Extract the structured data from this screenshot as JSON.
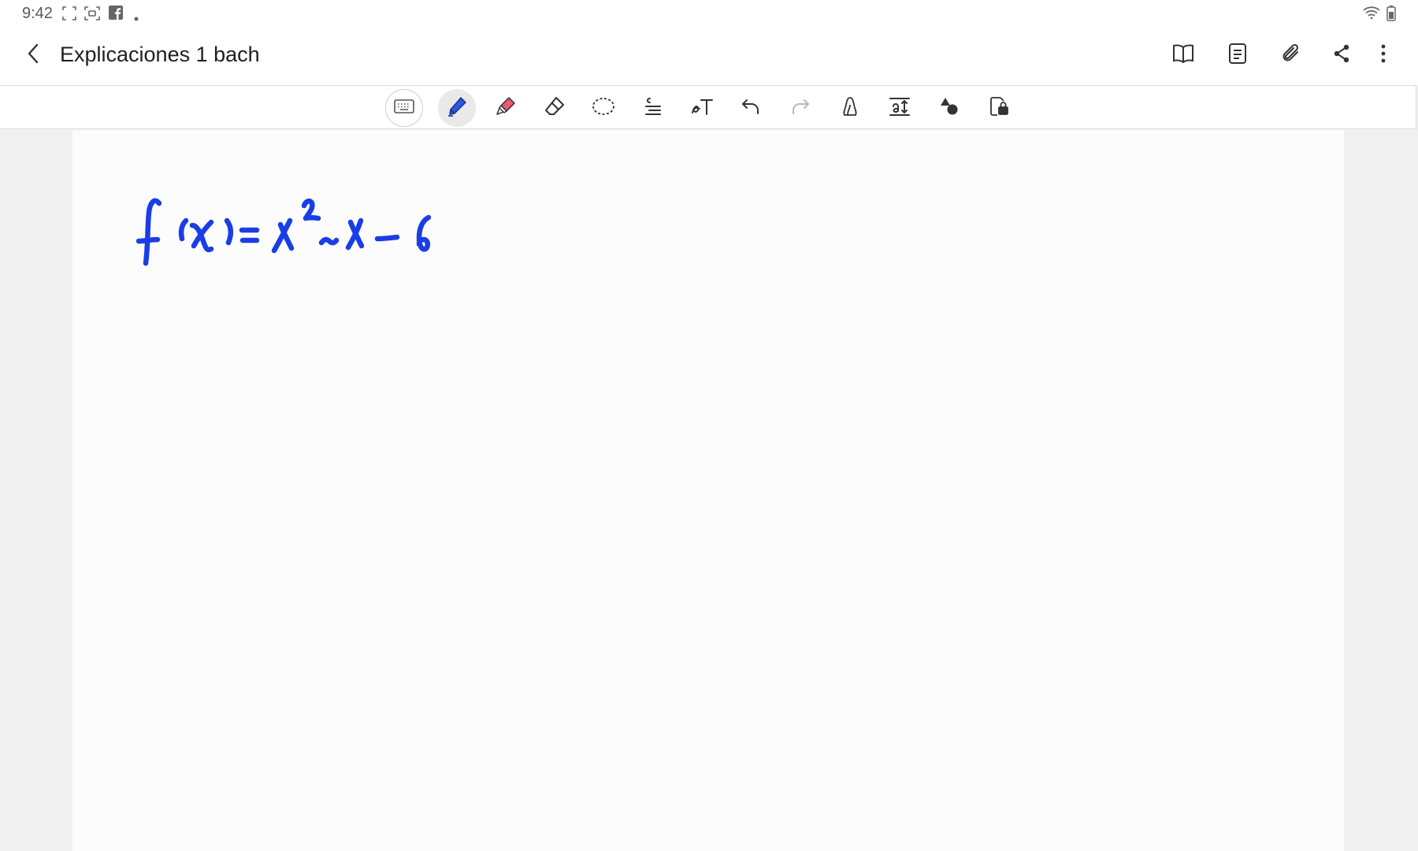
{
  "status_bar": {
    "time": "9:42",
    "icons": [
      "screenshot-frame-icon",
      "screen-record-icon",
      "facebook-icon",
      "notification-dot-icon",
      "wifi-icon",
      "battery-icon"
    ]
  },
  "title_bar": {
    "back_icon": "chevron-left-icon",
    "title": "Explicaciones 1 bach",
    "actions": [
      "book-view-icon",
      "page-list-icon",
      "attachment-icon",
      "share-icon",
      "more-vertical-icon"
    ]
  },
  "toolbar": {
    "tools": [
      {
        "name": "keyboard-icon",
        "state": "outlined"
      },
      {
        "name": "pen-icon",
        "state": "selected"
      },
      {
        "name": "highlighter-icon",
        "state": "normal"
      },
      {
        "name": "eraser-icon",
        "state": "normal"
      },
      {
        "name": "lasso-select-icon",
        "state": "normal"
      },
      {
        "name": "straighten-icon",
        "state": "normal"
      },
      {
        "name": "handwriting-to-text-icon",
        "state": "normal"
      },
      {
        "name": "undo-icon",
        "state": "normal"
      },
      {
        "name": "redo-icon",
        "state": "disabled"
      },
      {
        "name": "shape-fill-icon",
        "state": "normal"
      },
      {
        "name": "text-size-icon",
        "state": "normal"
      },
      {
        "name": "shapes-icon",
        "state": "normal"
      },
      {
        "name": "read-only-lock-icon",
        "state": "normal"
      }
    ]
  },
  "canvas": {
    "ink_text": "f(x)=x²−x−6",
    "ink_color": "#1a3ee6"
  },
  "colors": {
    "pen_accent": "#2d56e0",
    "highlighter_accent": "#e85a6f",
    "background": "#f0f0f0",
    "page": "#fcfcfc"
  }
}
